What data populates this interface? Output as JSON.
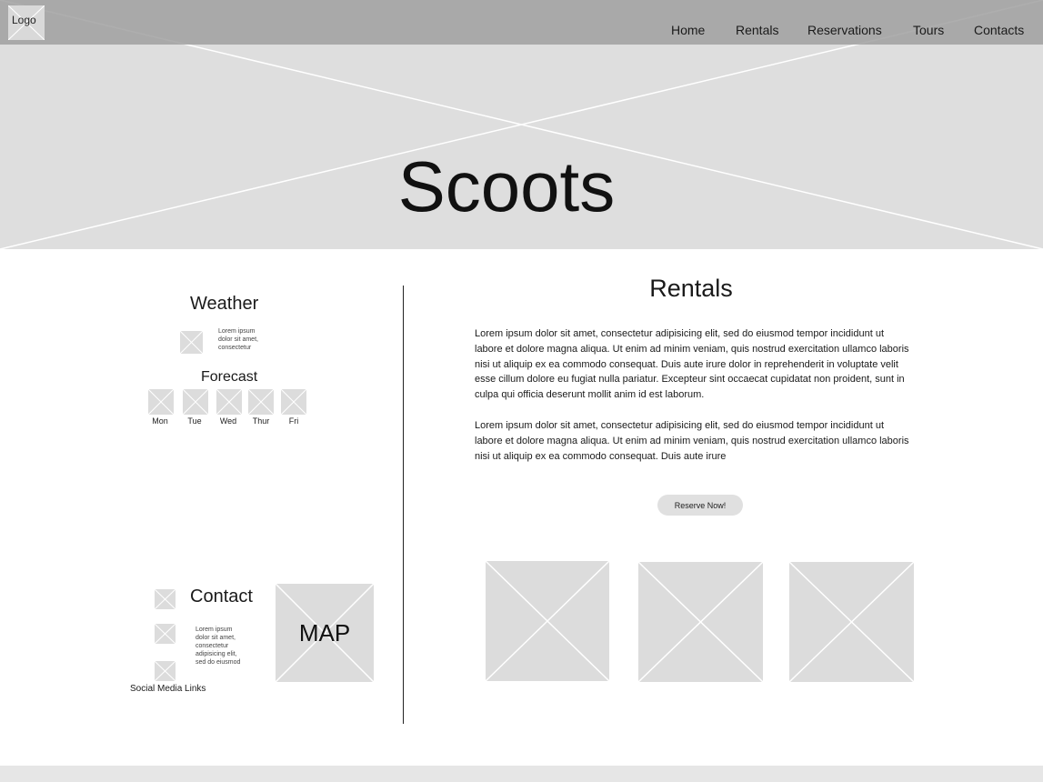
{
  "header": {
    "logo_label": "Logo",
    "nav": [
      "Home",
      "Rentals",
      "Reservations",
      "Tours",
      "Contacts"
    ],
    "hero_title": "Scoots"
  },
  "weather": {
    "title": "Weather",
    "lines": [
      "Lorem ipsum",
      "dolor sit amet,",
      "consectetur"
    ],
    "forecast_title": "Forecast",
    "days": [
      "Mon",
      "Tue",
      "Wed",
      "Thur",
      "Fri"
    ]
  },
  "contact": {
    "title": "Contact",
    "lines": [
      "Lorem ipsum",
      "dolor sit amet,",
      "consectetur",
      "adipisicing elit,",
      "sed do eiusmod"
    ],
    "social_label": "Social Media Links",
    "map_label": "MAP"
  },
  "rentals": {
    "title": "Rentals",
    "paragraph1": "Lorem ipsum dolor sit amet, consectetur adipisicing elit, sed do eiusmod tempor incididunt ut labore et dolore magna aliqua. Ut enim ad minim veniam, quis nostrud exercitation ullamco laboris nisi ut aliquip ex ea commodo consequat. Duis aute irure dolor in reprehenderit in voluptate velit esse cillum dolore eu fugiat nulla pariatur. Excepteur sint occaecat cupidatat non proident, sunt in culpa qui officia deserunt mollit anim id est laborum.",
    "paragraph2": "Lorem ipsum dolor sit amet, consectetur adipisicing elit, sed do eiusmod tempor incididunt ut labore et dolore magna aliqua. Ut enim ad minim veniam, quis nostrud exercitation ullamco laboris nisi ut aliquip ex ea commodo consequat. Duis aute irure",
    "reserve_label": "Reserve Now!"
  },
  "colors": {
    "topbar": "#a9a9a9",
    "hero_bg": "#dedede",
    "placeholder": "#dcdcdc"
  }
}
